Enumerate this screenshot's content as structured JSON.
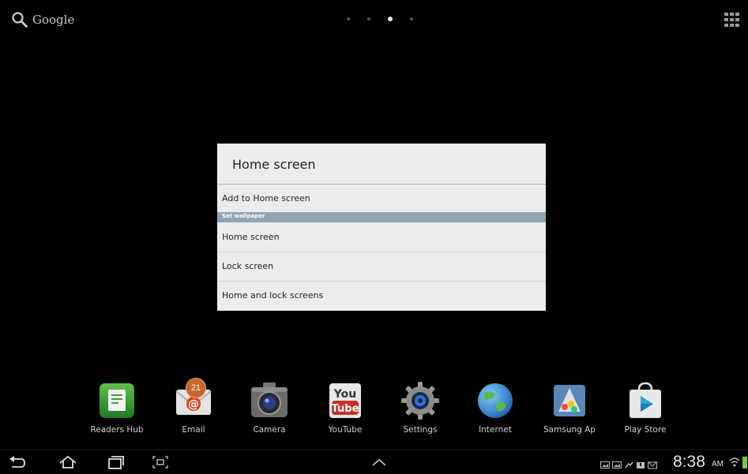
{
  "top_bar": {
    "search_label": "Google",
    "page_count": 4,
    "active_page": 3
  },
  "dialog": {
    "title": "Home screen",
    "items": [
      {
        "label": "Add to Home screen"
      },
      {
        "label": "Home screen"
      },
      {
        "label": "Lock screen"
      },
      {
        "label": "Home and lock screens"
      }
    ],
    "section_header": "Set wallpaper"
  },
  "dock": {
    "apps": [
      {
        "label": "Readers Hub",
        "icon": "readers-hub-icon"
      },
      {
        "label": "Email",
        "icon": "email-icon",
        "badge": "21"
      },
      {
        "label": "Camera",
        "icon": "camera-icon"
      },
      {
        "label": "YouTube",
        "icon": "youtube-icon",
        "icon_text_top": "You",
        "icon_text_bottom": "Tube"
      },
      {
        "label": "Settings",
        "icon": "settings-icon"
      },
      {
        "label": "Internet",
        "icon": "internet-icon"
      },
      {
        "label": "Samsung Ap",
        "icon": "samsung-apps-icon"
      },
      {
        "label": "Play Store",
        "icon": "play-store-icon"
      }
    ]
  },
  "status_bar": {
    "time": "8:38",
    "ampm": "AM"
  },
  "colors": {
    "dialog_bg": "#ececec",
    "section_header_bg": "#8fa5b3",
    "battery": "#7ac943"
  }
}
